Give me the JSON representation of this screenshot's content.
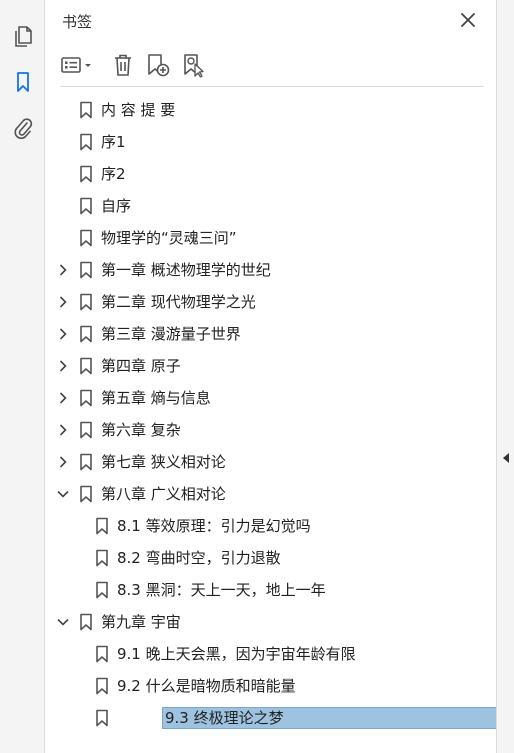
{
  "panel": {
    "title": "书签"
  },
  "bookmarks": [
    {
      "label": "内 容 提 要",
      "level": 0,
      "expandable": false
    },
    {
      "label": "序1",
      "level": 0,
      "expandable": false
    },
    {
      "label": "序2",
      "level": 0,
      "expandable": false
    },
    {
      "label": "自序",
      "level": 0,
      "expandable": false
    },
    {
      "label": "物理学的“灵魂三问”",
      "level": 0,
      "expandable": false
    },
    {
      "label": "第一章 概述物理学的世纪",
      "level": 0,
      "expandable": true,
      "expanded": false
    },
    {
      "label": "第二章 现代物理学之光",
      "level": 0,
      "expandable": true,
      "expanded": false
    },
    {
      "label": "第三章 漫游量子世界",
      "level": 0,
      "expandable": true,
      "expanded": false
    },
    {
      "label": "第四章 原子",
      "level": 0,
      "expandable": true,
      "expanded": false
    },
    {
      "label": "第五章 熵与信息",
      "level": 0,
      "expandable": true,
      "expanded": false
    },
    {
      "label": "第六章 复杂",
      "level": 0,
      "expandable": true,
      "expanded": false
    },
    {
      "label": "第七章 狭义相对论",
      "level": 0,
      "expandable": true,
      "expanded": false
    },
    {
      "label": "第八章 广义相对论",
      "level": 0,
      "expandable": true,
      "expanded": true
    },
    {
      "label": "8.1 等效原理：引力是幻觉吗",
      "level": 1,
      "expandable": false
    },
    {
      "label": "8.2 弯曲时空，引力退散",
      "level": 1,
      "expandable": false
    },
    {
      "label": "8.3 黑洞：天上一天，地上一年",
      "level": 1,
      "expandable": false
    },
    {
      "label": "第九章 宇宙",
      "level": 0,
      "expandable": true,
      "expanded": true
    },
    {
      "label": "9.1 晚上天会黑，因为宇宙年龄有限",
      "level": 1,
      "expandable": false
    },
    {
      "label": "9.2 什么是暗物质和暗能量",
      "level": 1,
      "expandable": false
    },
    {
      "label": "9.3 终极理论之梦",
      "level": 1,
      "expandable": false,
      "selected": true
    }
  ],
  "colors": {
    "accent": "#1473e6",
    "selection": "#9ec3e0",
    "icon": "#555555"
  }
}
